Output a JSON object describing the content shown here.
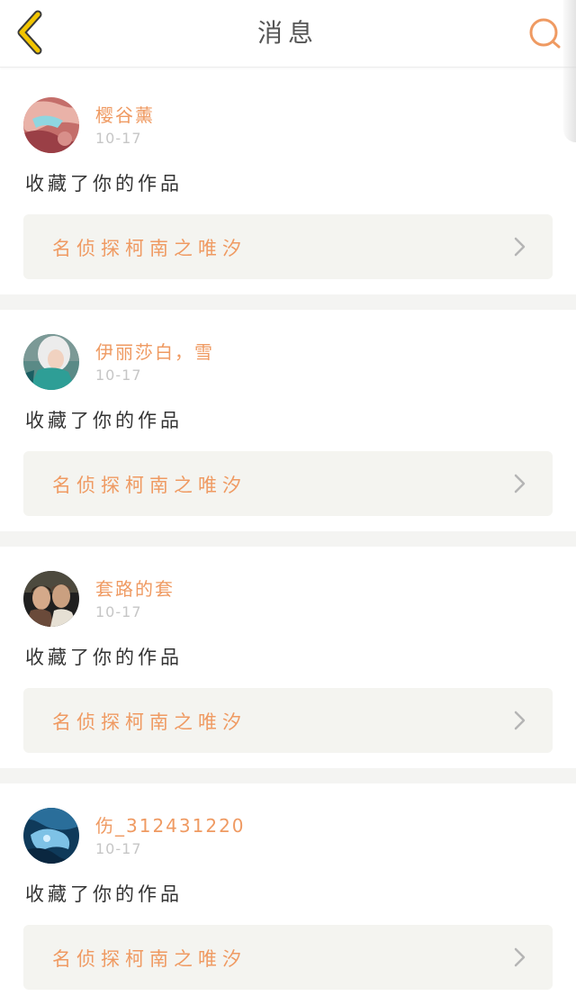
{
  "header": {
    "title": "消息",
    "back_icon": "chevron-left-icon",
    "search_icon": "search-icon"
  },
  "colors": {
    "accent": "#ef9a62",
    "back_icon": "#e9b800",
    "separator": "#f4f4f2",
    "work_card_bg": "#f4f4f0"
  },
  "notifications": [
    {
      "username": "樱谷薰",
      "date": "10-17",
      "action": "收藏了你的作品",
      "work_title": "名侦探柯南之唯汐"
    },
    {
      "username": "伊丽莎白，雪",
      "date": "10-17",
      "action": "收藏了你的作品",
      "work_title": "名侦探柯南之唯汐"
    },
    {
      "username": "套路的套",
      "date": "10-17",
      "action": "收藏了你的作品",
      "work_title": "名侦探柯南之唯汐"
    },
    {
      "username": "伤_312431220",
      "date": "10-17",
      "action": "收藏了你的作品",
      "work_title": "名侦探柯南之唯汐"
    }
  ]
}
